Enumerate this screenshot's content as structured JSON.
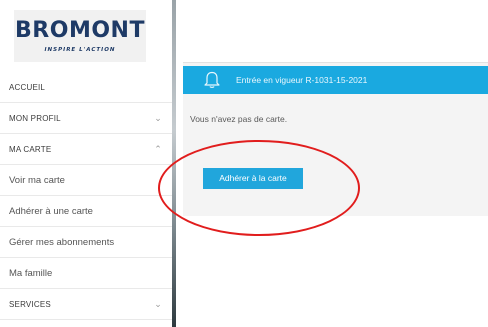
{
  "logo": {
    "word": "BROMONT",
    "tagline": "INSPIRE L'ACTION"
  },
  "nav": {
    "items": [
      {
        "label": "ACCUEIL",
        "chevron": ""
      },
      {
        "label": "MON PROFIL",
        "chevron": "⌄"
      },
      {
        "label": "MA CARTE",
        "chevron": "⌃"
      },
      {
        "label": "Voir ma carte",
        "chevron": ""
      },
      {
        "label": "Adhérer à une carte",
        "chevron": ""
      },
      {
        "label": "Gérer mes abonnements",
        "chevron": ""
      },
      {
        "label": "Ma famille",
        "chevron": ""
      },
      {
        "label": "SERVICES",
        "chevron": "⌄"
      }
    ]
  },
  "banner": {
    "icon": "bell-icon",
    "text": "Entrée en vigueur R-1031-15-2021"
  },
  "card": {
    "message": "Vous n'avez pas de carte.",
    "button_label": "Adhérer à la carte"
  },
  "colors": {
    "accent": "#1aa9e0",
    "annotation": "#e11d1d",
    "brand": "#1e3a66"
  }
}
